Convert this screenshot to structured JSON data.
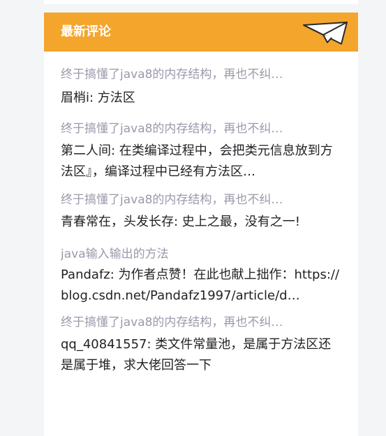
{
  "widget": {
    "title": "最新评论",
    "icon": "paper-plane-icon",
    "accent_color": "#f4a52b"
  },
  "comments": [
    {
      "article": "终于搞懂了java8的内存结构，再也不纠…",
      "text": "眉梢i: 方法区"
    },
    {
      "article": "终于搞懂了java8的内存结构，再也不纠…",
      "text": "第二人间: 在类编译过程中，会把类元信息放到方法区』，编译过程中已经有方法区…"
    },
    {
      "article": "终于搞懂了java8的内存结构，再也不纠…",
      "text": "青春常在，头发长存: 史上之最，没有之一!"
    },
    {
      "article": "java输入输出的方法",
      "text": "Pandafz: 为作者点赞！在此也献上拙作：https://blog.csdn.net/Pandafz1997/article/d…"
    },
    {
      "article": "终于搞懂了java8的内存结构，再也不纠…",
      "text": "qq_40841557: 类文件常量池，是属于方法区还是属于堆，求大佬回答一下"
    }
  ]
}
